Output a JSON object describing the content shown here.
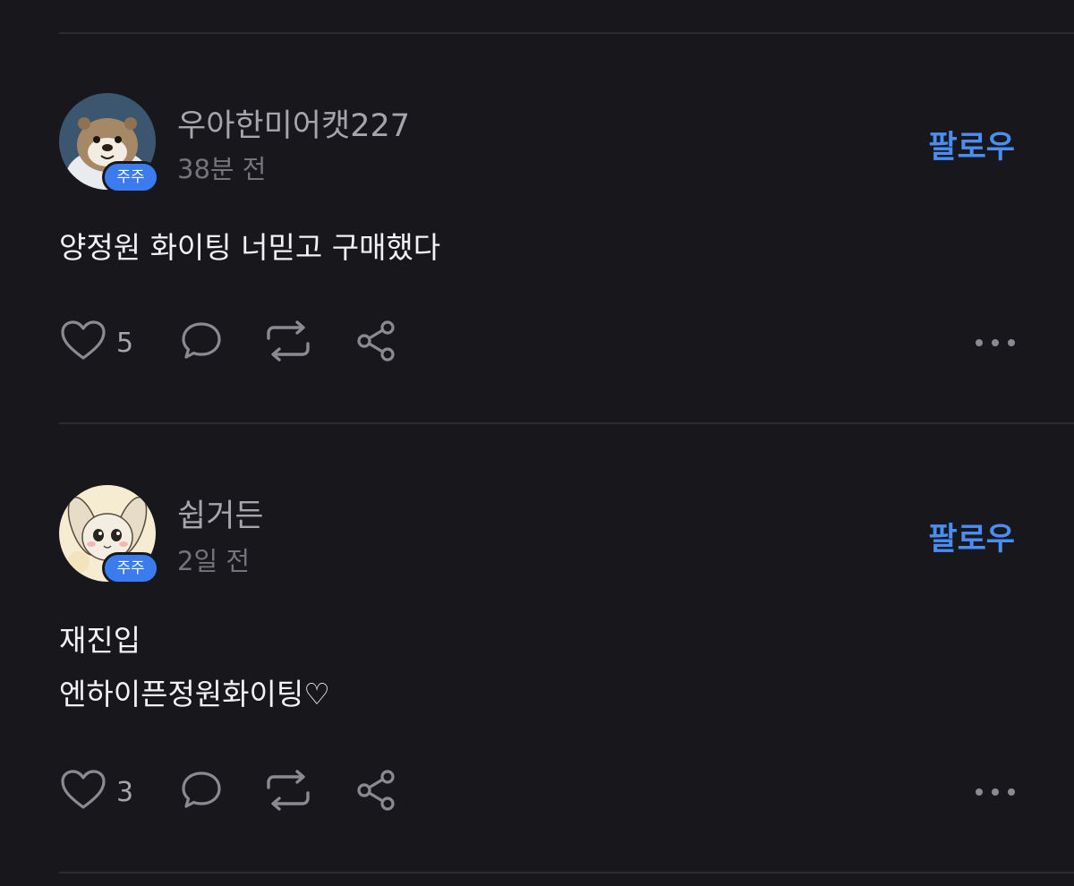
{
  "posts": [
    {
      "username": "우아한미어캣227",
      "badge": "주주",
      "time": "38분 전",
      "follow_label": "팔로우",
      "lines": [
        "양정원 화이팅 너믿고 구매했다"
      ],
      "like_count": "5",
      "avatar_icon": "otter-avatar"
    },
    {
      "username": "쉽거든",
      "badge": "주주",
      "time": "2일 전",
      "follow_label": "팔로우",
      "lines": [
        "재진입",
        "엔하이픈정원화이팅♡"
      ],
      "like_count": "3",
      "avatar_icon": "bunny-avatar"
    }
  ],
  "colors": {
    "background": "#18181c",
    "accent": "#4a8df5",
    "badge": "#3a7cf0",
    "muted_text": "#a5a5ab",
    "icon": "#8a8a90"
  }
}
